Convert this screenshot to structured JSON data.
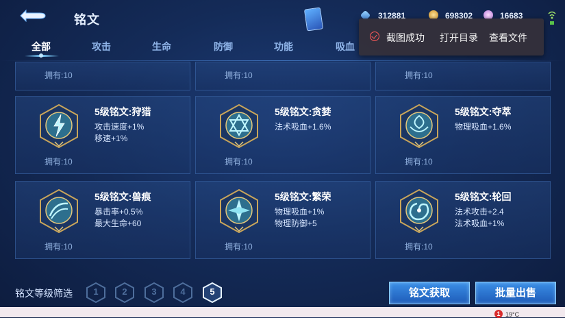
{
  "header": {
    "title": "铭文",
    "currencies": [
      {
        "icon": "diamond-icon",
        "value": "312881"
      },
      {
        "icon": "gold-coin-icon",
        "value": "698302"
      },
      {
        "icon": "crystal-icon",
        "value": "16683"
      }
    ]
  },
  "tabs": [
    {
      "label": "全部",
      "active": true
    },
    {
      "label": "攻击",
      "active": false
    },
    {
      "label": "生命",
      "active": false
    },
    {
      "label": "防御",
      "active": false
    },
    {
      "label": "功能",
      "active": false
    },
    {
      "label": "吸血",
      "active": false
    }
  ],
  "toast": {
    "message": "截图成功",
    "open_dir": "打开目录",
    "view_file": "查看文件"
  },
  "top_row": [
    {
      "owned": "拥有:10"
    },
    {
      "owned": "拥有:10"
    },
    {
      "owned": "拥有:10"
    }
  ],
  "runes": [
    {
      "name": "5级铭文:狩猎",
      "attrs": [
        "攻击速度+1%",
        "移速+1%"
      ],
      "owned": "拥有:10",
      "icon": "lightning-rune-icon"
    },
    {
      "name": "5级铭文:贪婪",
      "attrs": [
        "法术吸血+1.6%"
      ],
      "owned": "拥有:10",
      "icon": "star-rune-icon"
    },
    {
      "name": "5级铭文:夺萃",
      "attrs": [
        "物理吸血+1.6%"
      ],
      "owned": "拥有:10",
      "icon": "knot-rune-icon"
    },
    {
      "name": "5级铭文:兽痕",
      "attrs": [
        "暴击率+0.5%",
        "最大生命+60"
      ],
      "owned": "拥有:10",
      "icon": "claw-rune-icon"
    },
    {
      "name": "5级铭文:繁荣",
      "attrs": [
        "物理吸血+1%",
        "物理防御+5"
      ],
      "owned": "拥有:10",
      "icon": "crystal-rune-icon"
    },
    {
      "name": "5级铭文:轮回",
      "attrs": [
        "法术攻击+2.4",
        "法术吸血+1%"
      ],
      "owned": "拥有:10",
      "icon": "swirl-rune-icon"
    }
  ],
  "filter": {
    "label": "铭文等级筛选",
    "levels": [
      "1",
      "2",
      "3",
      "4",
      "5"
    ],
    "selected": "5"
  },
  "buttons": {
    "obtain": "铭文获取",
    "sell": "批量出售"
  },
  "status": {
    "badge": "1",
    "temperature": "19°C"
  }
}
